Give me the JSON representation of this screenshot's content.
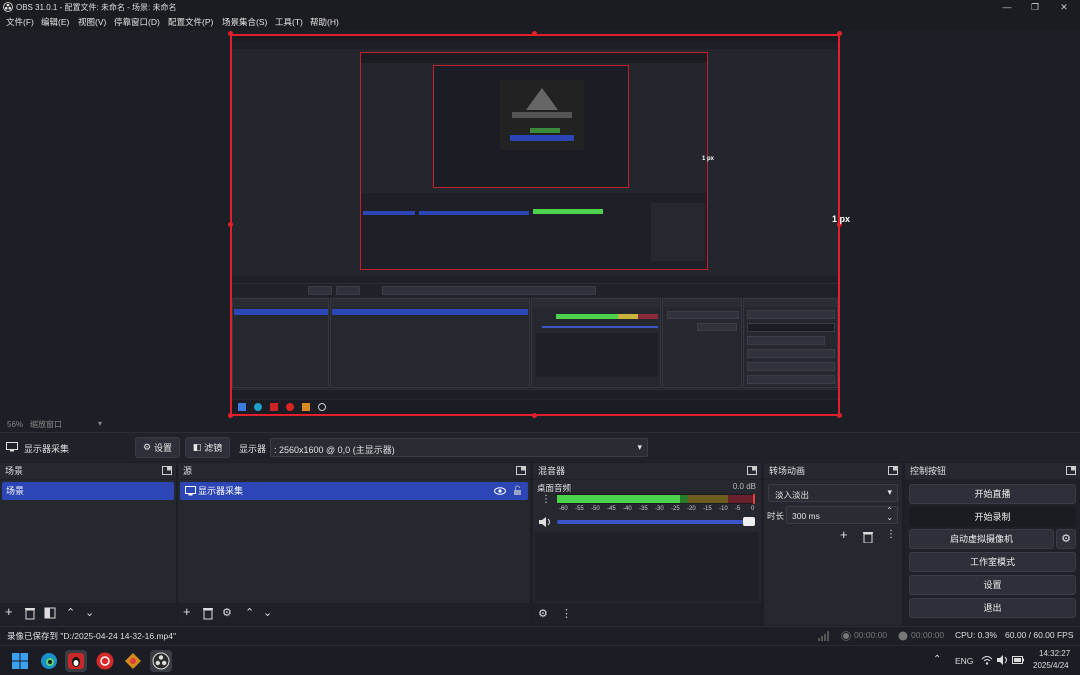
{
  "window": {
    "title": "OBS 31.0.1 - 配置文件: 未命名 - 场景: 未命名",
    "min": "—",
    "max": "❐",
    "close": "✕"
  },
  "menu": [
    "文件(F)",
    "编辑(E)",
    "视图(V)",
    "停靠窗口(D)",
    "配置文件(P)",
    "场景集合(S)",
    "工具(T)",
    "帮助(H)"
  ],
  "preview": {
    "label_right": "1 px",
    "label_inner": "1 px"
  },
  "zoom": {
    "value": "56%",
    "mode": "缩放窗口"
  },
  "source_toolbar": {
    "source_name": "显示器采集",
    "settings": "设置",
    "filters": "滤镜",
    "display_label": "显示器",
    "display_value": ": 2560x1600 @ 0,0 (主显示器)"
  },
  "scenes": {
    "title": "场景",
    "items": [
      "场景"
    ]
  },
  "sources": {
    "title": "源",
    "items": [
      "显示器采集"
    ]
  },
  "mixer": {
    "title": "混音器",
    "channel": "桌面音频",
    "db": "0.0 dB",
    "scale": [
      "-60",
      "-55",
      "-50",
      "-45",
      "-40",
      "-35",
      "-30",
      "-25",
      "-20",
      "-15",
      "-10",
      "-5",
      "0"
    ],
    "volume": 1.0
  },
  "transitions": {
    "title": "转场动画",
    "selected": "淡入淡出",
    "duration_label": "时长",
    "duration_value": "300 ms"
  },
  "controls": {
    "title": "控制按钮",
    "buttons": [
      "开始直播",
      "开始录制",
      "启动虚拟摄像机",
      "工作室模式",
      "设置",
      "退出"
    ]
  },
  "status": {
    "message": "录像已保存到 \"D:/2025-04-24 14-32-16.mp4\"",
    "stream_time": "00:00:00",
    "rec_time": "00:00:00",
    "cpu": "CPU: 0.3%",
    "fps": "60.00 / 60.00 FPS"
  },
  "taskbar": {
    "lang": "ENG",
    "time": "14:32:27",
    "date": "2025/4/24"
  },
  "colors": {
    "accent": "#2c47b5",
    "selection_border": "#e2202c",
    "meter_green": "#4cd24c",
    "meter_yellow": "#c8b43a",
    "meter_red": "#d84040"
  }
}
